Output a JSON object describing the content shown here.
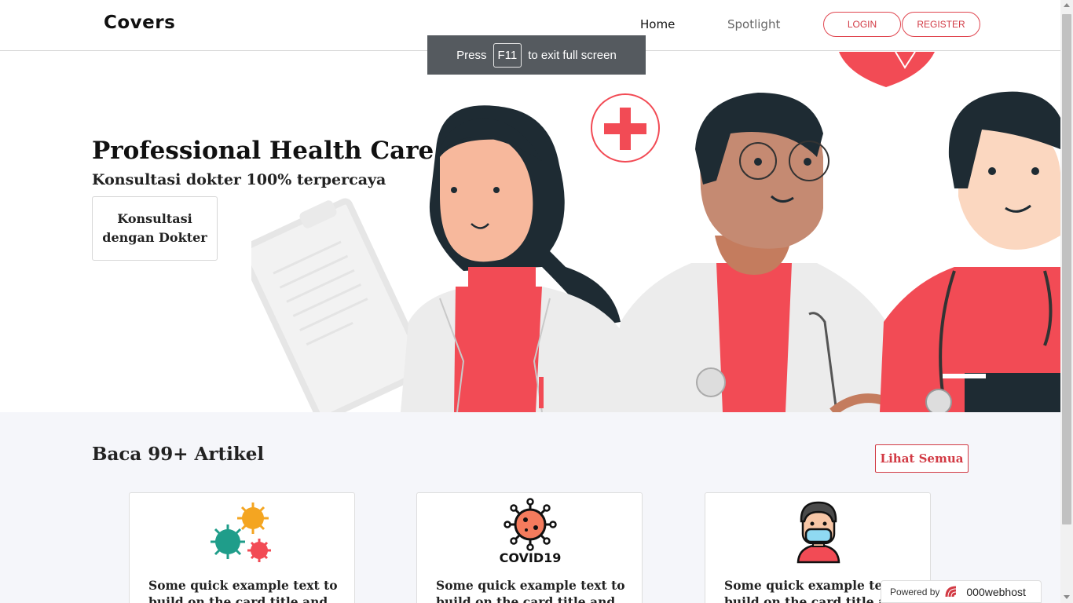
{
  "navbar": {
    "brand": "Covers",
    "links": [
      {
        "label": "Home",
        "active": true
      },
      {
        "label": "Spotlight",
        "active": false
      }
    ],
    "login_label": "LOGIN",
    "register_label": "REGISTER"
  },
  "fullscreen_toast": {
    "prefix": "Press",
    "key": "F11",
    "suffix": "to exit full screen"
  },
  "hero": {
    "title": "Professional Health Care",
    "subtitle": "Konsultasi dokter 100% terpercaya",
    "cta_line1": "Konsultasi",
    "cta_line2": "dengan Dokter",
    "illustration_icon": "doctors-illustration"
  },
  "articles": {
    "heading": "Baca 99+ Artikel",
    "see_all_label": "Lihat Semua",
    "cards": [
      {
        "image_icon": "virus-cluster-icon",
        "text": "Some quick example text to build on the card title and"
      },
      {
        "image_icon": "covid19-virus-icon",
        "image_caption": "COVID19",
        "text": "Some quick example text to build on the card title and"
      },
      {
        "image_icon": "masked-person-icon",
        "text": "Some quick example text to build on the card title and"
      }
    ]
  },
  "footer_badge": {
    "prefix": "Powered by",
    "brand": "000webhost"
  },
  "colors": {
    "accent": "#d23a44",
    "illustration_red": "#f24b55",
    "dark_hair": "#1e2b33",
    "section_bg": "#f5f6fa"
  }
}
